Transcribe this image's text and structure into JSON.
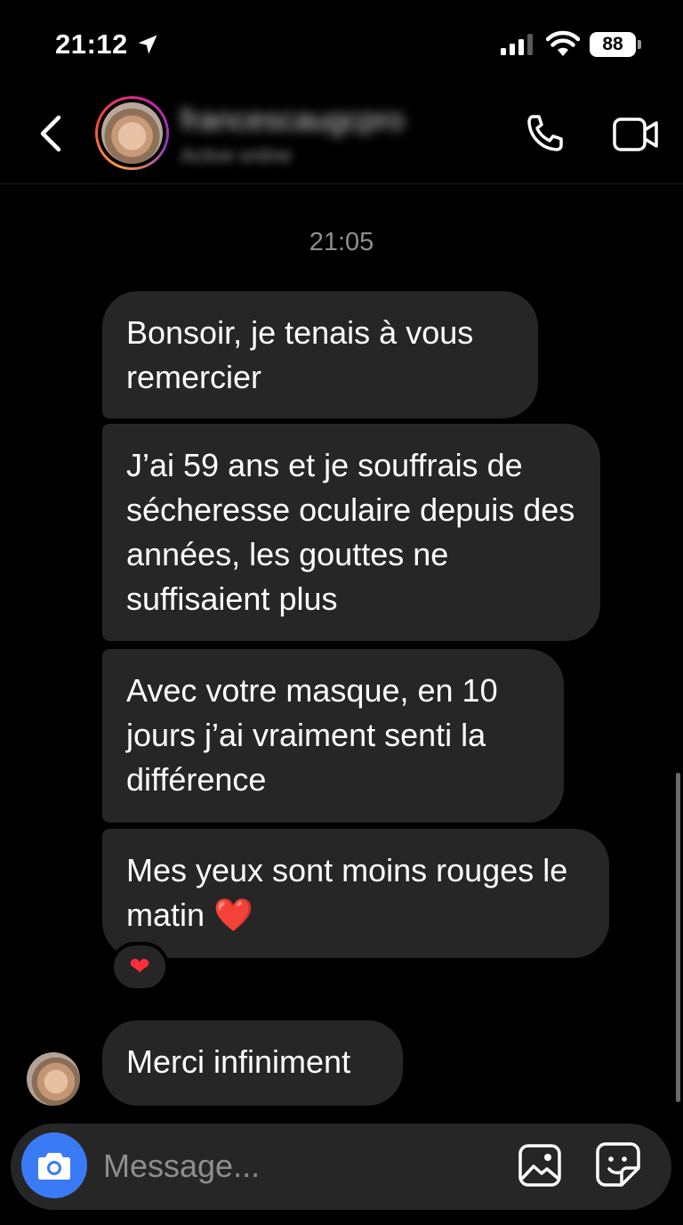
{
  "status_bar": {
    "time": "21:12",
    "battery": "88",
    "icons": [
      "location-arrow-icon",
      "cellular-signal-icon",
      "wifi-icon",
      "battery-icon"
    ]
  },
  "header": {
    "contact_name": "francescaugcpro",
    "contact_status": "Active online",
    "icons": [
      "back-chevron-icon",
      "phone-icon",
      "video-camera-icon"
    ]
  },
  "conversation": {
    "timestamp": "21:05",
    "messages": [
      {
        "text": "Bonsoir, je tenais à vous remercier"
      },
      {
        "text": "J’ai 59 ans et je souffrais de sécheresse oculaire depuis des années, les gouttes ne suffisaient plus"
      },
      {
        "text": "Avec votre masque, en 10 jours j’ai vraiment senti la différence"
      },
      {
        "text": "Mes yeux sont moins rouges le matin ❤️"
      }
    ],
    "reaction": "❤",
    "reply": {
      "text": "Merci infiniment"
    }
  },
  "composer": {
    "placeholder": "Message...",
    "icons": [
      "camera-icon",
      "gallery-icon",
      "sticker-icon"
    ]
  },
  "colors": {
    "background": "#000000",
    "bubble": "#262626",
    "camera_button": "#3a7bf5",
    "muted_text": "#8e8e8e"
  }
}
